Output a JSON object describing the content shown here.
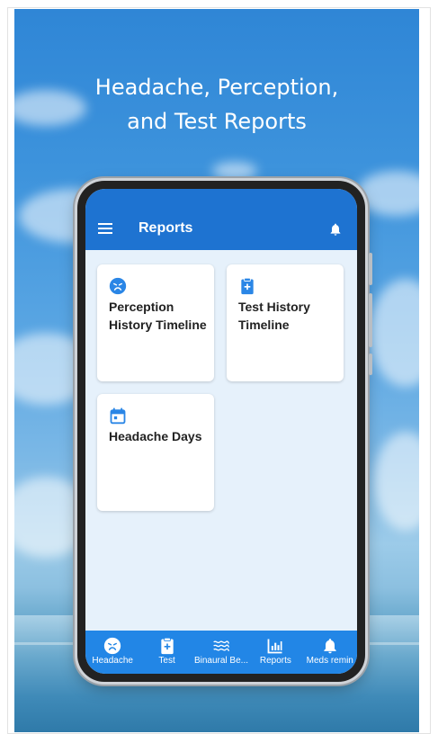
{
  "poster": {
    "headline_line1": "Headache, Perception,",
    "headline_line2": "and Test Reports"
  },
  "appbar": {
    "title": "Reports",
    "menu_icon": "hamburger-menu-icon",
    "notification_icon": "bell-icon"
  },
  "cards": [
    {
      "icon": "sad-face-icon",
      "label": "Perception History Timeline"
    },
    {
      "icon": "clipboard-plus-icon",
      "label": "Test History Timeline"
    },
    {
      "icon": "calendar-icon",
      "label": "Headache Days"
    }
  ],
  "nav": [
    {
      "icon": "sad-face-icon",
      "label": "Headache"
    },
    {
      "icon": "clipboard-plus-icon",
      "label": "Test"
    },
    {
      "icon": "waves-icon",
      "label": "Binaural Be..."
    },
    {
      "icon": "bar-chart-icon",
      "label": "Reports"
    },
    {
      "icon": "bell-icon",
      "label": "Meds remin"
    }
  ],
  "colors": {
    "appbar": "#1e73d1",
    "nav": "#2286e6",
    "icon_blue": "#2a86e6",
    "screen_bg": "#e6f1fb"
  }
}
